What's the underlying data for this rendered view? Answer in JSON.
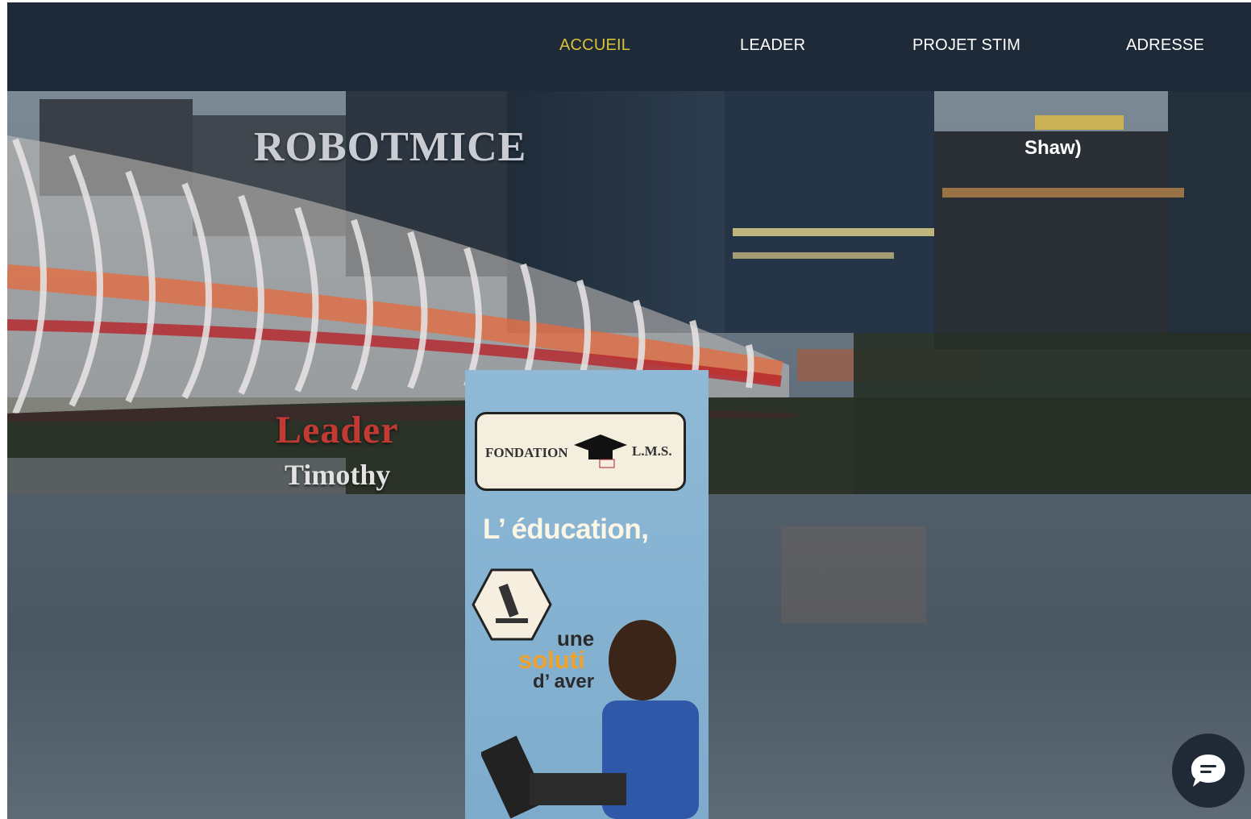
{
  "nav": {
    "items": [
      {
        "label": "ACCUEIL",
        "active": true
      },
      {
        "label": "LEADER",
        "active": false
      },
      {
        "label": "PROJET STIM",
        "active": false
      },
      {
        "label": "ADRESSE",
        "active": false
      }
    ]
  },
  "hero": {
    "title": "ROBOTMICE",
    "leader_label": "Leader",
    "leader_name": "Timothy",
    "sign_text": "Shaw)"
  },
  "banner": {
    "logo_left": "FONDATION",
    "logo_right": "L.M.S.",
    "headline": "L’ éducation,",
    "line1": "une",
    "line2": "soluti",
    "line3": "d’ aver"
  },
  "chat": {
    "icon": "chat-bubble-icon"
  },
  "colors": {
    "nav_bg": "#1e2a37",
    "nav_active": "#d8c23a",
    "leader_red": "#c13a33",
    "banner_blue": "#8fb9d6",
    "banner_orange": "#f0a12b"
  }
}
